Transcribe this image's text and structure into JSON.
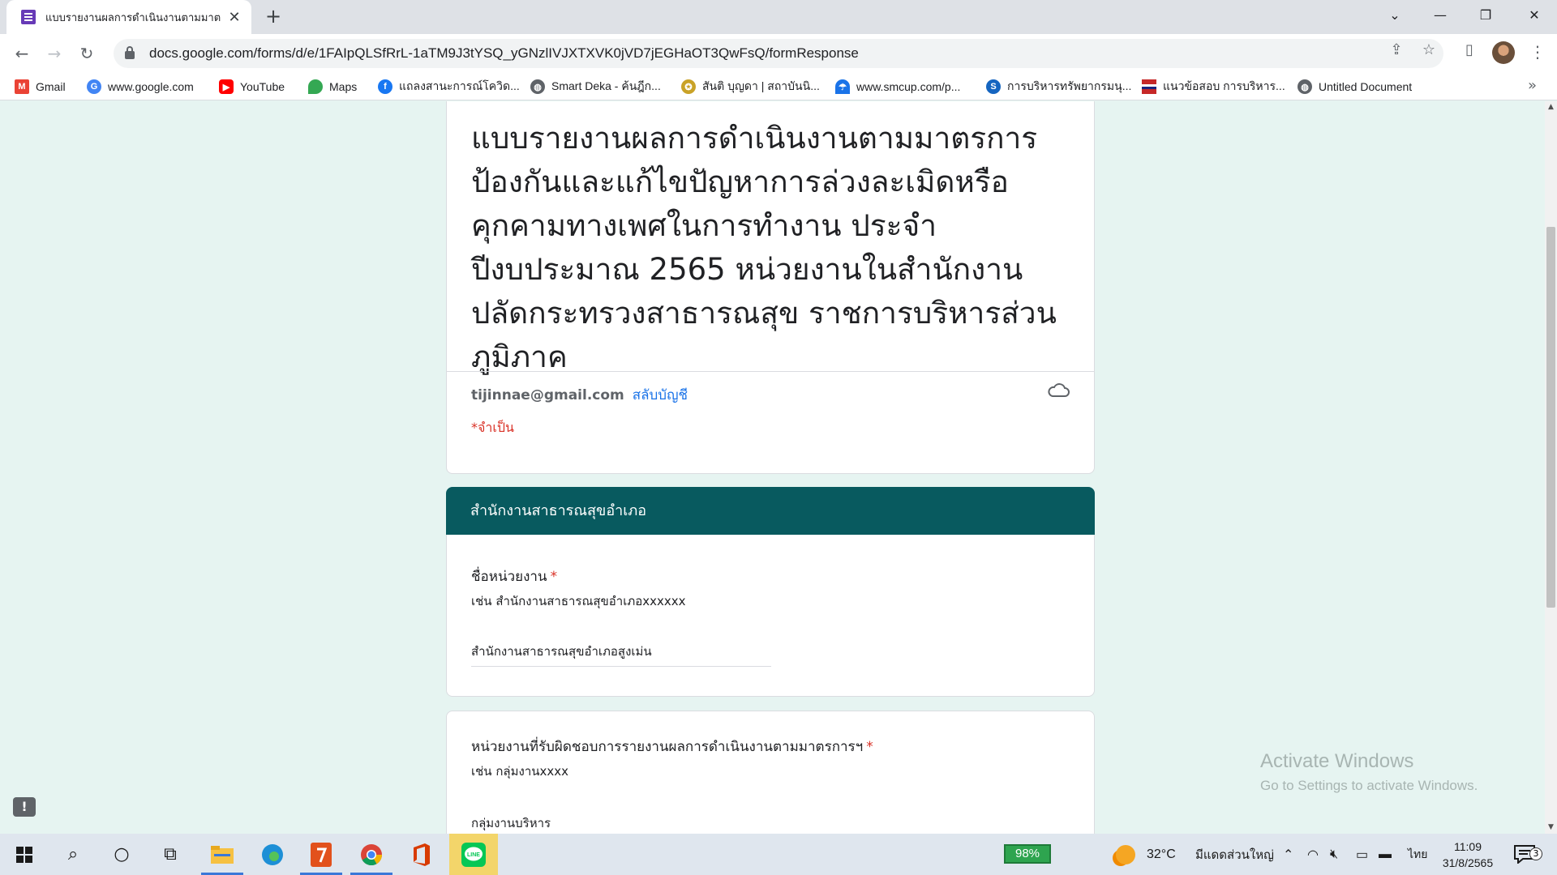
{
  "browser": {
    "tab_title": "แบบรายงานผลการดำเนินงานตามมาต",
    "url": "docs.google.com/forms/d/e/1FAIpQLSfRrL-1aTM9J3tYSQ_yGNzlIVJXTXVK0jVD7jEGHaOT3QwFsQ/formResponse",
    "new_tab": "+",
    "window_controls": [
      "⌄",
      "—",
      "❐",
      "✕"
    ]
  },
  "bookmarks": [
    {
      "label": "Gmail",
      "icon": "gmail-icon",
      "color": "#ea4335"
    },
    {
      "label": "www.google.com",
      "icon": "google-icon",
      "color": "#4285f4"
    },
    {
      "label": "YouTube",
      "icon": "youtube-icon",
      "color": "#ff0000"
    },
    {
      "label": "Maps",
      "icon": "maps-icon",
      "color": "#34a853"
    },
    {
      "label": "แถลงสานะการณ์โควิด...",
      "icon": "facebook-icon",
      "color": "#1877f2"
    },
    {
      "label": "Smart Deka - ค้นฎีก...",
      "icon": "globe-icon",
      "color": "#5f6368"
    },
    {
      "label": "สันติ บุญดา | สถาบันนิ...",
      "icon": "emblem-icon",
      "color": "#c9a227"
    },
    {
      "label": "www.smcup.com/p...",
      "icon": "umbrella-icon",
      "color": "#1a73e8"
    },
    {
      "label": "การบริหารทรัพยากรมนุ...",
      "icon": "s-icon",
      "color": "#1565c0"
    },
    {
      "label": "แนวข้อสอบ การบริหาร...",
      "icon": "flag-icon",
      "color": "#c62828"
    },
    {
      "label": "Untitled Document",
      "icon": "globe-icon",
      "color": "#5f6368"
    }
  ],
  "form": {
    "title": "แบบรายงานผลการดำเนินงานตามมาตรการป้องกันและแก้ไขปัญหาการล่วงละเมิดหรือคุกคามทางเพศในการทำงาน ประจำปีงบประมาณ 2565 หน่วยงานในสำนักงานปลัดกระทรวงสาธารณสุข  ราชการบริหารส่วนภูมิภาค",
    "account_email": "tijinnae@gmail.com",
    "switch_account": "สลับบัญชี",
    "required_note": "*จำเป็น",
    "section_title": "สำนักงานสาธารณสุขอำเภอ",
    "questions": [
      {
        "label": "ชื่อหน่วยงาน",
        "required": "*",
        "help": "เช่น สำนักงานสาธารณสุขอำเภอxxxxxx",
        "answer": "สำนักงานสาธารณสุขอำเภอสูงเม่น"
      },
      {
        "label": "หน่วยงานที่รับผิดชอบการรายงานผลการดำเนินงานตามมาตรการฯ",
        "required": "*",
        "help": "เช่น กลุ่มงานxxxx",
        "answer": "กลุ่มงานบริหาร"
      }
    ]
  },
  "watermark": {
    "line1": "Activate Windows",
    "line2": "Go to Settings to activate Windows."
  },
  "taskbar": {
    "battery": "98%",
    "temperature": "32°C",
    "weather": "มีแดดส่วนใหญ่",
    "language": "ไทย",
    "time": "11:09",
    "date": "31/8/2565",
    "notification_count": "3"
  },
  "colors": {
    "accent": "#085a5f",
    "background": "#e6f4f1",
    "required": "#d93025",
    "link": "#1a73e8"
  }
}
